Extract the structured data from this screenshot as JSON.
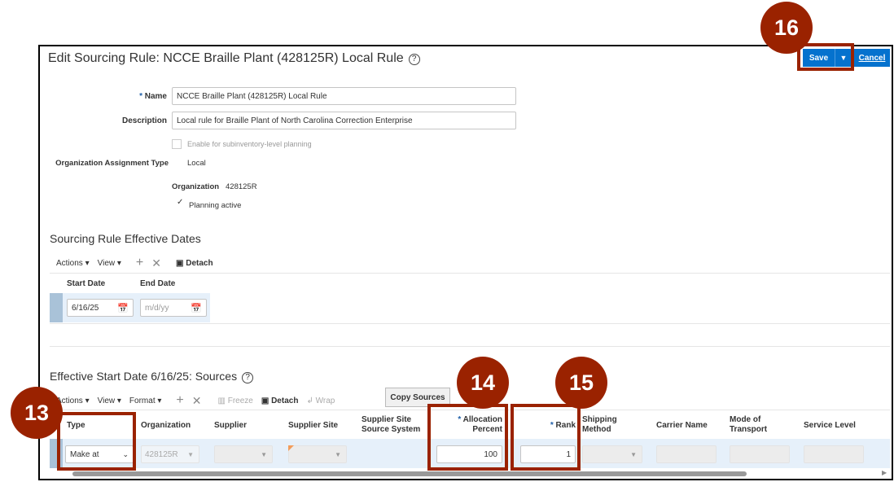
{
  "page": {
    "title": "Edit Sourcing Rule: NCCE Braille Plant (428125R) Local Rule",
    "help_icon": "?"
  },
  "header": {
    "save_label": "Save",
    "save_menu_icon": "▼",
    "cancel_label": "Cancel"
  },
  "form": {
    "name_label": "Name",
    "name_value": "NCCE Braille Plant (428125R) Local Rule",
    "description_label": "Description",
    "description_value": "Local rule for Braille Plant of North Carolina Correction Enterprise",
    "subinventory_label": "Enable for subinventory-level planning",
    "org_assignment_label": "Organization Assignment Type",
    "org_assignment_value": "Local",
    "organization_label": "Organization",
    "organization_value": "428125R",
    "planning_active_label": "Planning active",
    "check": "✓"
  },
  "dates": {
    "title": "Sourcing Rule Effective Dates",
    "toolbar": {
      "actions": "Actions",
      "view": "View",
      "detach": "Detach"
    },
    "columns": [
      "Start Date",
      "End Date"
    ],
    "start_value": "6/16/25",
    "end_placeholder": "m/d/yy"
  },
  "sources": {
    "title": "Effective Start Date 6/16/25: Sources",
    "toolbar": {
      "actions": "Actions",
      "view": "View",
      "format": "Format",
      "freeze": "Freeze",
      "detach": "Detach",
      "wrap": "Wrap",
      "copy_sources": "Copy Sources"
    },
    "columns": {
      "type": "Type",
      "organization": "Organization",
      "supplier": "Supplier",
      "supplier_site": "Supplier Site",
      "supplier_site_source_1": "Supplier Site",
      "supplier_site_source_2": "Source System",
      "allocation_1": "Allocation",
      "allocation_2": "Percent",
      "rank": "Rank",
      "shipping_1": "Shipping",
      "shipping_2": "Method",
      "carrier": "Carrier Name",
      "mode_1": "Mode of",
      "mode_2": "Transport",
      "service": "Service Level"
    },
    "row": {
      "type": "Make at",
      "organization": "428125R",
      "allocation": "100",
      "rank": "1"
    }
  },
  "callouts": [
    "13",
    "14",
    "15",
    "16"
  ],
  "colors": {
    "accent": "#0572ce",
    "callout": "#9a2200"
  }
}
